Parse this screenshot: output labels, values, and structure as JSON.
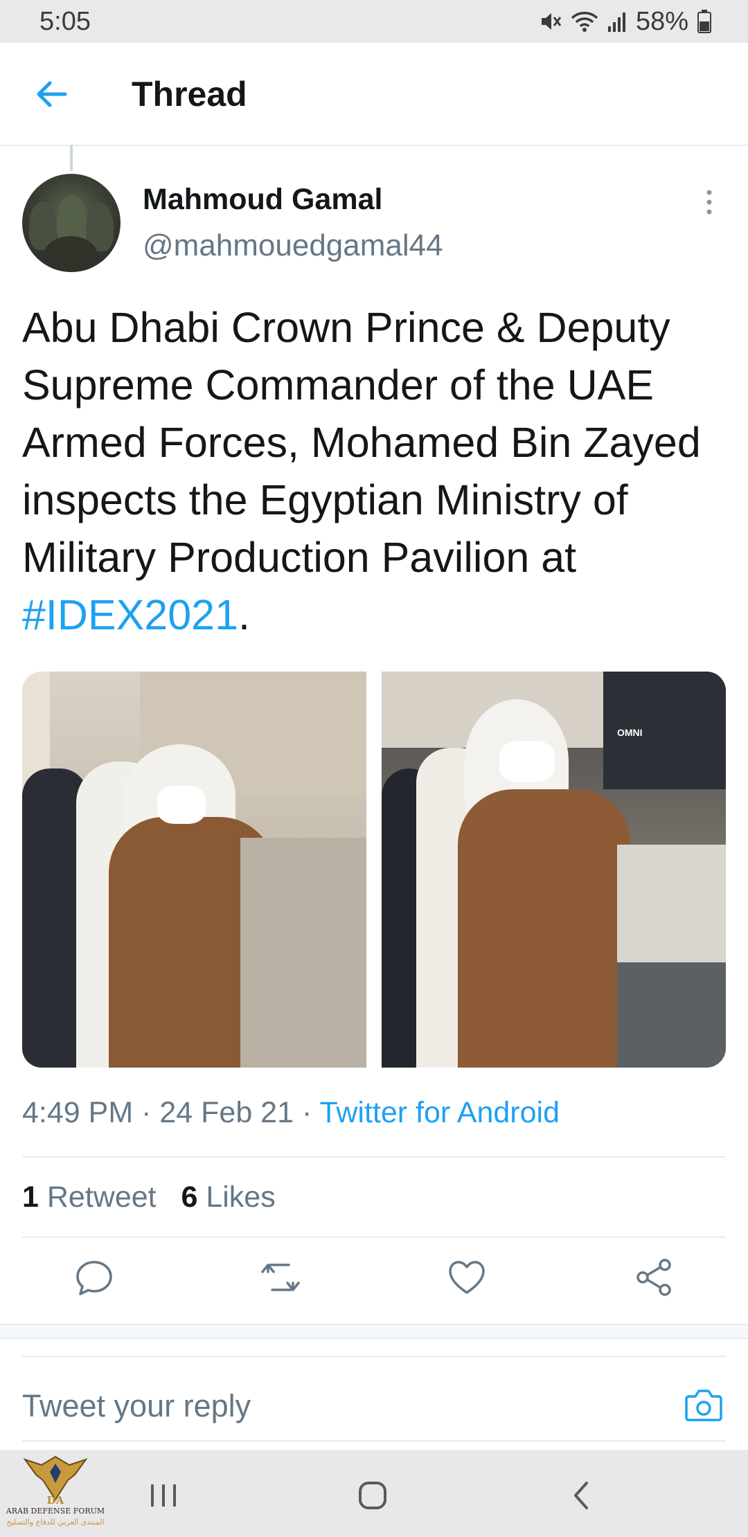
{
  "status_bar": {
    "time": "5:05",
    "battery": "58%"
  },
  "header": {
    "title": "Thread"
  },
  "tweet": {
    "author_name": "Mahmoud Gamal",
    "author_handle": "@mahmouedgamal44",
    "text_before_tag": "Abu Dhabi Crown Prince & Deputy Supreme Commander of the UAE Armed Forces, Mohamed Bin Zayed inspects the Egyptian Ministry of Military Production Pavilion at ",
    "hashtag": "#IDEX2021",
    "text_after_tag": ".",
    "photo_text": "OMNI",
    "time": "4:49 PM",
    "date": "24 Feb 21",
    "source": "Twitter for Android",
    "separator": " · ",
    "retweet_count": "1",
    "retweet_label": "Retweet",
    "like_count": "6",
    "like_label": "Likes"
  },
  "reply": {
    "placeholder": "Tweet your reply"
  },
  "watermark": {
    "line1": "DA",
    "line2": "ARAB DEFENSE FORUM",
    "line3": "المنتدى العربي للدفاع والتسليح"
  },
  "icons": {
    "back": "back-arrow-icon",
    "more": "more-vertical-icon",
    "reply": "reply-icon",
    "retweet": "retweet-icon",
    "like": "like-icon",
    "share": "share-icon",
    "camera": "camera-icon",
    "mute": "mute-icon",
    "wifi": "wifi-icon",
    "signal": "signal-icon",
    "battery": "battery-icon",
    "recents": "recents-icon",
    "home": "home-icon",
    "nav_back": "nav-back-icon"
  },
  "colors": {
    "accent": "#1da1f2",
    "text": "#14171a",
    "secondary": "#657786",
    "divider": "#e6ecf0"
  }
}
